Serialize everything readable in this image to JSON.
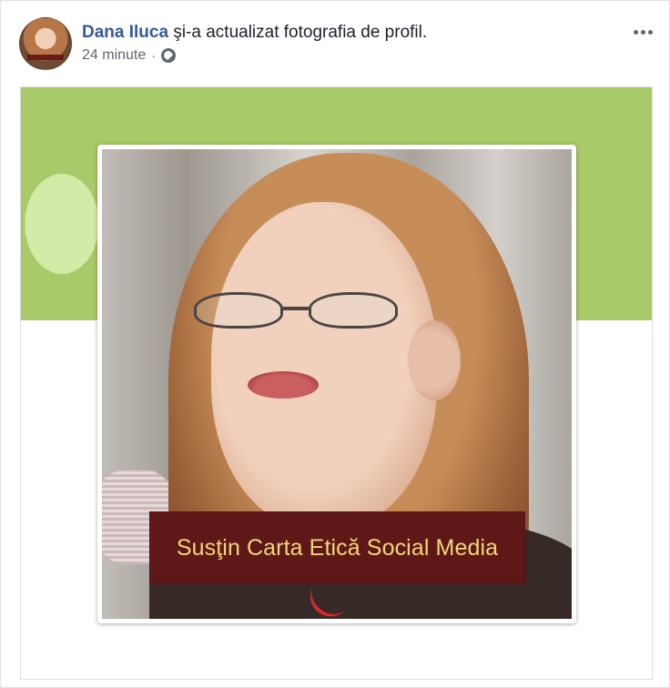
{
  "post": {
    "author_name": "Dana Iluca",
    "action_text": " şi-a actualizat fotografia de profil.",
    "time": "24 minute",
    "separator": "·",
    "privacy_icon": "globe-icon",
    "more_icon": "more-icon"
  },
  "media": {
    "profile_overlay_text": "Susţin Carta Etică Social Media"
  }
}
